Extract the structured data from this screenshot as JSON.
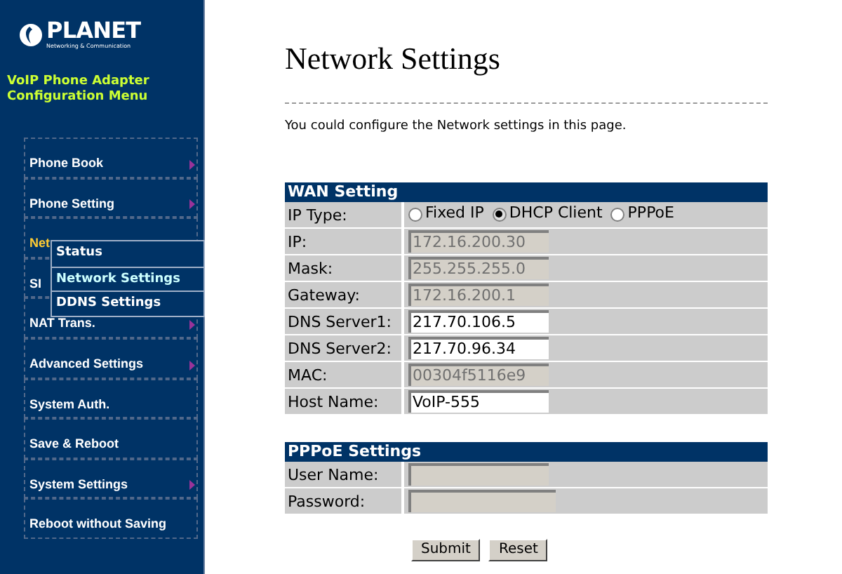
{
  "sidebar": {
    "logo": {
      "name": "PLANET",
      "tagline": "Networking & Communication"
    },
    "heading": "VoIP Phone Adapter Configuration Menu",
    "items": [
      {
        "label": "Phone Book",
        "arrow": true,
        "selected": false
      },
      {
        "label": "Phone Setting",
        "arrow": true,
        "selected": false
      },
      {
        "label": "Net",
        "selected": true
      },
      {
        "label": "SI",
        "selected": false
      },
      {
        "label": "NAT Trans.",
        "arrow": true,
        "selected": false
      },
      {
        "label": "Advanced Settings",
        "arrow": true,
        "selected": false
      },
      {
        "label": "System Auth.",
        "arrow": false,
        "selected": false
      },
      {
        "label": "Save & Reboot",
        "arrow": false,
        "selected": false
      },
      {
        "label": "System Settings",
        "arrow": true,
        "selected": false
      },
      {
        "label": "Reboot without Saving",
        "arrow": false,
        "selected": false
      }
    ],
    "submenu": [
      {
        "label": "Status",
        "selected": false
      },
      {
        "label": "Network Settings",
        "selected": true
      },
      {
        "label": "DDNS Settings",
        "selected": false
      }
    ]
  },
  "page": {
    "title": "Network Settings",
    "intro": "You could configure the Network settings in this page."
  },
  "wan": {
    "header": "WAN Setting",
    "rows": [
      {
        "kind": "radio",
        "label": "IP Type:",
        "options": [
          {
            "label": "Fixed IP",
            "selected": false
          },
          {
            "label": "DHCP Client",
            "selected": true
          },
          {
            "label": "PPPoE",
            "selected": false
          }
        ]
      },
      {
        "kind": "field",
        "label": "IP:",
        "value": "172.16.200.30",
        "disabled": true
      },
      {
        "kind": "field",
        "label": "Mask:",
        "value": "255.255.255.0",
        "disabled": true
      },
      {
        "kind": "field",
        "label": "Gateway:",
        "value": "172.16.200.1",
        "disabled": true
      },
      {
        "kind": "field",
        "label": "DNS Server1:",
        "value": "217.70.106.5",
        "disabled": false
      },
      {
        "kind": "field",
        "label": "DNS Server2:",
        "value": "217.70.96.34",
        "disabled": false
      },
      {
        "kind": "field",
        "label": "MAC:",
        "value": "00304f5116e9",
        "disabled": true
      },
      {
        "kind": "field",
        "label": "Host Name:",
        "value": "VoIP-555",
        "disabled": false
      }
    ]
  },
  "pppoe": {
    "header": "PPPoE Settings",
    "rows": [
      {
        "kind": "field",
        "label": "User Name:",
        "disabled": true
      },
      {
        "kind": "field",
        "label": "Password:",
        "disabled": true
      }
    ]
  },
  "buttons": [
    "Submit",
    "Reset"
  ]
}
